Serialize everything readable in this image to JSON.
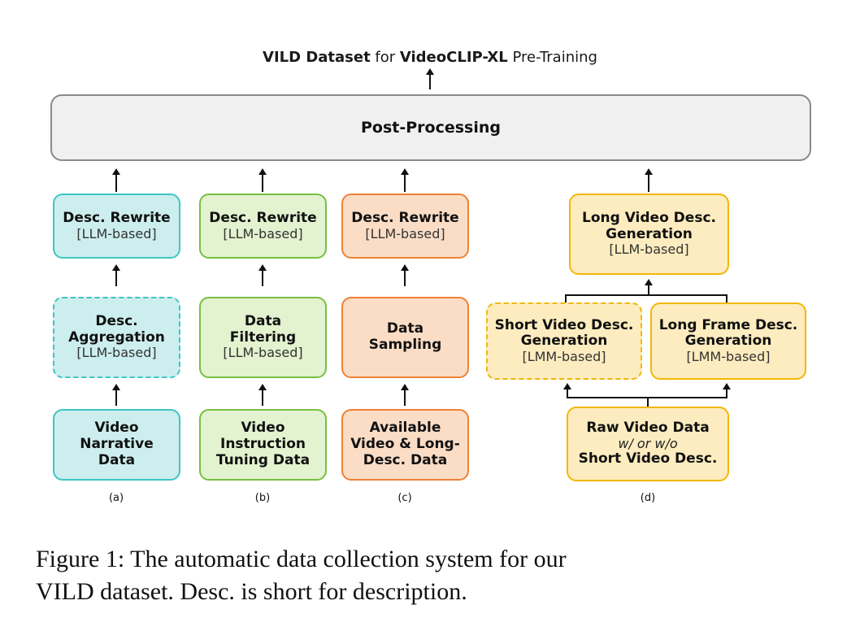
{
  "title": {
    "part1": "VILD Dataset",
    "part2": " for ",
    "part3": "VideoCLIP-XL",
    "part4": " Pre-Training"
  },
  "header": {
    "label": "Post-Processing"
  },
  "columns": [
    {
      "key": "a",
      "label": "(a)",
      "color": "#3fc4c4",
      "fill": "#cdeeee",
      "boxes": [
        {
          "name": "desc-rewrite-a",
          "lines": [
            {
              "text": "Desc. Rewrite",
              "style": "bold"
            },
            {
              "text": "[LLM-based]",
              "style": "light"
            }
          ]
        },
        {
          "name": "desc-aggregation",
          "dashed": true,
          "lines": [
            {
              "text": "Desc.",
              "style": "bold"
            },
            {
              "text": "Aggregation",
              "style": "bold"
            },
            {
              "text": "[LLM-based]",
              "style": "light"
            }
          ]
        },
        {
          "name": "video-narrative-data",
          "lines": [
            {
              "text": "Video",
              "style": "bold"
            },
            {
              "text": "Narrative",
              "style": "bold"
            },
            {
              "text": "Data",
              "style": "bold"
            }
          ]
        }
      ]
    },
    {
      "key": "b",
      "label": "(b)",
      "color": "#76c043",
      "fill": "#e3f2cf",
      "boxes": [
        {
          "name": "desc-rewrite-b",
          "lines": [
            {
              "text": "Desc. Rewrite",
              "style": "bold"
            },
            {
              "text": "[LLM-based]",
              "style": "light"
            }
          ]
        },
        {
          "name": "data-filtering",
          "lines": [
            {
              "text": "Data",
              "style": "bold"
            },
            {
              "text": "Filtering",
              "style": "bold"
            },
            {
              "text": "[LLM-based]",
              "style": "light"
            }
          ]
        },
        {
          "name": "video-instruction-tuning-data",
          "lines": [
            {
              "text": "Video",
              "style": "bold"
            },
            {
              "text": "Instruction",
              "style": "bold"
            },
            {
              "text": "Tuning Data",
              "style": "bold"
            }
          ]
        }
      ]
    },
    {
      "key": "c",
      "label": "(c)",
      "color": "#ef8136",
      "fill": "#fbddc6",
      "boxes": [
        {
          "name": "desc-rewrite-c",
          "lines": [
            {
              "text": "Desc. Rewrite",
              "style": "bold"
            },
            {
              "text": "[LLM-based]",
              "style": "light"
            }
          ]
        },
        {
          "name": "data-sampling",
          "lines": [
            {
              "text": "Data",
              "style": "bold"
            },
            {
              "text": "Sampling",
              "style": "bold"
            }
          ]
        },
        {
          "name": "available-video-long-desc-data",
          "lines": [
            {
              "text": "Available",
              "style": "bold"
            },
            {
              "text": "Video & Long-",
              "style": "bold"
            },
            {
              "text": "Desc. Data",
              "style": "bold"
            }
          ]
        }
      ]
    },
    {
      "key": "d",
      "label": "(d)",
      "color": "#f2b705",
      "fill": "#fdecbf",
      "boxes": [
        {
          "name": "long-video-desc-generation",
          "lines": [
            {
              "text": "Long Video Desc.",
              "style": "bold"
            },
            {
              "text": "Generation",
              "style": "bold"
            },
            {
              "text": "[LLM-based]",
              "style": "light"
            }
          ]
        },
        {
          "name": "short-video-desc-generation",
          "dashed": true,
          "lines": [
            {
              "text": "Short Video Desc.",
              "style": "bold"
            },
            {
              "text": "Generation",
              "style": "bold"
            },
            {
              "text": "[LMM-based]",
              "style": "light"
            }
          ]
        },
        {
          "name": "long-frame-desc-generation",
          "lines": [
            {
              "text": "Long Frame Desc.",
              "style": "bold"
            },
            {
              "text": "Generation",
              "style": "bold"
            },
            {
              "text": "[LMM-based]",
              "style": "light"
            }
          ]
        },
        {
          "name": "raw-video-data",
          "lines": [
            {
              "text": "Raw Video Data",
              "style": "bold"
            },
            {
              "text": "w/ or w/o",
              "style": "ital"
            },
            {
              "text": "Short Video Desc.",
              "style": "bold"
            }
          ]
        }
      ]
    }
  ],
  "caption": {
    "line1": "Figure 1: The automatic data collection system for our",
    "line2": "VILD dataset. Desc. is short for description."
  }
}
